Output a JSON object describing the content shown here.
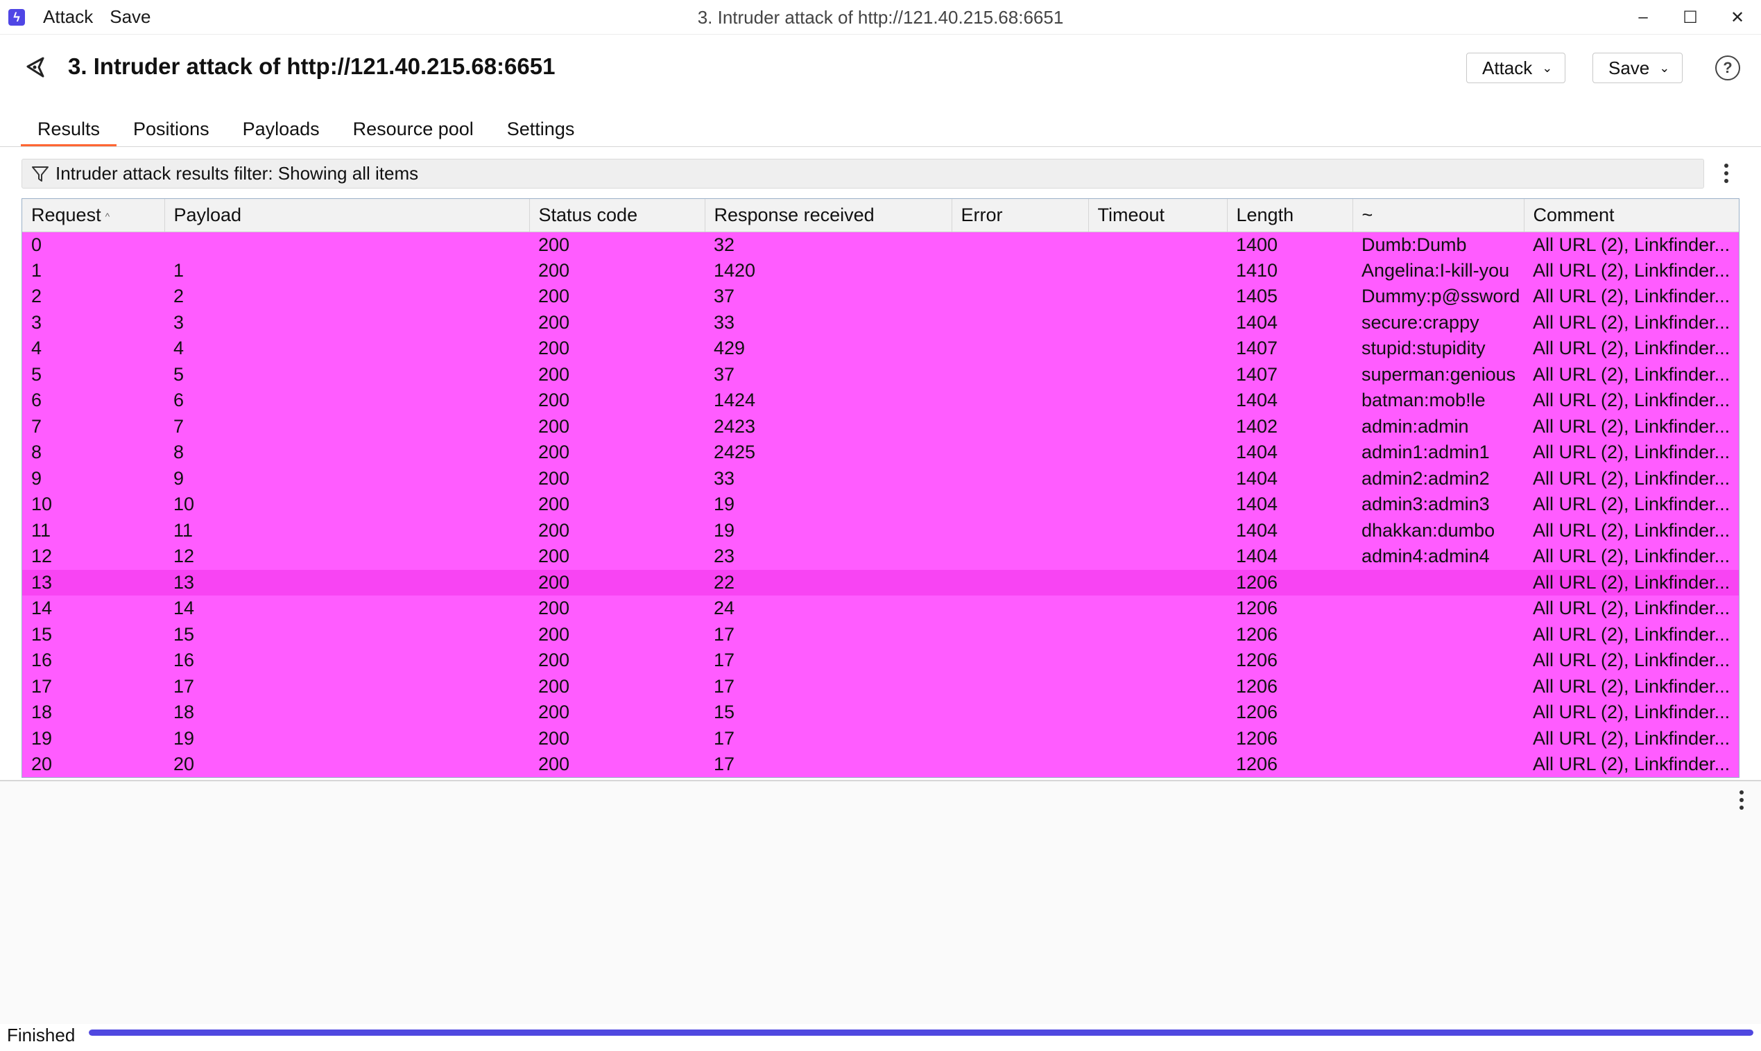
{
  "window": {
    "title": "3. Intruder attack of http://121.40.215.68:6651",
    "menu": [
      "Attack",
      "Save"
    ],
    "controls": {
      "minimize": "–",
      "maximize": "☐",
      "close": "✕"
    }
  },
  "header": {
    "title": "3. Intruder attack of http://121.40.215.68:6651",
    "attack_label": "Attack",
    "save_label": "Save",
    "help": "?"
  },
  "tabs": [
    {
      "label": "Results",
      "active": true
    },
    {
      "label": "Positions",
      "active": false
    },
    {
      "label": "Payloads",
      "active": false
    },
    {
      "label": "Resource pool",
      "active": false
    },
    {
      "label": "Settings",
      "active": false
    }
  ],
  "filter": {
    "text": "Intruder attack results filter: Showing all items"
  },
  "table": {
    "columns": [
      "Request",
      "Payload",
      "Status code",
      "Response received",
      "Error",
      "Timeout",
      "Length",
      "~",
      "Comment"
    ],
    "sorted_column": "Request",
    "row_color": "#ff5cff",
    "selected_row_color": "#f844f3",
    "selected_row_index": 13,
    "rows": [
      [
        "0",
        "",
        "200",
        "32",
        "",
        "",
        "1400",
        "Dumb:Dumb",
        "All URL (2), Linkfinder..."
      ],
      [
        "1",
        "1",
        "200",
        "1420",
        "",
        "",
        "1410",
        "Angelina:I-kill-you",
        "All URL (2), Linkfinder..."
      ],
      [
        "2",
        "2",
        "200",
        "37",
        "",
        "",
        "1405",
        "Dummy:p@ssword",
        "All URL (2), Linkfinder..."
      ],
      [
        "3",
        "3",
        "200",
        "33",
        "",
        "",
        "1404",
        "secure:crappy",
        "All URL (2), Linkfinder..."
      ],
      [
        "4",
        "4",
        "200",
        "429",
        "",
        "",
        "1407",
        "stupid:stupidity",
        "All URL (2), Linkfinder..."
      ],
      [
        "5",
        "5",
        "200",
        "37",
        "",
        "",
        "1407",
        "superman:genious",
        "All URL (2), Linkfinder..."
      ],
      [
        "6",
        "6",
        "200",
        "1424",
        "",
        "",
        "1404",
        "batman:mob!le",
        "All URL (2), Linkfinder..."
      ],
      [
        "7",
        "7",
        "200",
        "2423",
        "",
        "",
        "1402",
        "admin:admin",
        "All URL (2), Linkfinder..."
      ],
      [
        "8",
        "8",
        "200",
        "2425",
        "",
        "",
        "1404",
        "admin1:admin1",
        "All URL (2), Linkfinder..."
      ],
      [
        "9",
        "9",
        "200",
        "33",
        "",
        "",
        "1404",
        "admin2:admin2",
        "All URL (2), Linkfinder..."
      ],
      [
        "10",
        "10",
        "200",
        "19",
        "",
        "",
        "1404",
        "admin3:admin3",
        "All URL (2), Linkfinder..."
      ],
      [
        "11",
        "11",
        "200",
        "19",
        "",
        "",
        "1404",
        "dhakkan:dumbo",
        "All URL (2), Linkfinder..."
      ],
      [
        "12",
        "12",
        "200",
        "23",
        "",
        "",
        "1404",
        "admin4:admin4",
        "All URL (2), Linkfinder..."
      ],
      [
        "13",
        "13",
        "200",
        "22",
        "",
        "",
        "1206",
        "",
        "All URL (2), Linkfinder..."
      ],
      [
        "14",
        "14",
        "200",
        "24",
        "",
        "",
        "1206",
        "",
        "All URL (2), Linkfinder..."
      ],
      [
        "15",
        "15",
        "200",
        "17",
        "",
        "",
        "1206",
        "",
        "All URL (2), Linkfinder..."
      ],
      [
        "16",
        "16",
        "200",
        "17",
        "",
        "",
        "1206",
        "",
        "All URL (2), Linkfinder..."
      ],
      [
        "17",
        "17",
        "200",
        "17",
        "",
        "",
        "1206",
        "",
        "All URL (2), Linkfinder..."
      ],
      [
        "18",
        "18",
        "200",
        "15",
        "",
        "",
        "1206",
        "",
        "All URL (2), Linkfinder..."
      ],
      [
        "19",
        "19",
        "200",
        "17",
        "",
        "",
        "1206",
        "",
        "All URL (2), Linkfinder..."
      ],
      [
        "20",
        "20",
        "200",
        "17",
        "",
        "",
        "1206",
        "",
        "All URL (2), Linkfinder..."
      ]
    ]
  },
  "status": {
    "text": "Finished",
    "progress_percent": 100,
    "progress_color": "#5048e0"
  }
}
